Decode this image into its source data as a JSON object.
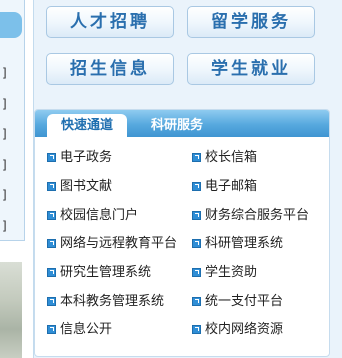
{
  "quick_buttons": [
    "人才招聘",
    "留学服务",
    "招生信息",
    "学生就业"
  ],
  "tabs": {
    "active": "快速通道",
    "inactive": "科研服务"
  },
  "links_left": [
    "电子政务",
    "图书文献",
    "校园信息门户",
    "网络与远程教育平台",
    "研究生管理系统",
    "本科教务管理系统",
    "信息公开"
  ],
  "links_right": [
    "校长信箱",
    "电子邮箱",
    "财务综合服务平台",
    "科研管理系统",
    "学生资助",
    "统一支付平台",
    "校内网络资源"
  ],
  "left_marks": [
    "]",
    "]",
    "]",
    "]",
    "]",
    "]"
  ],
  "colors": {
    "accent": "#2a6fae",
    "tab_bar": "#4ea1d9",
    "panel_bg": "#eaf3fb"
  },
  "icons": {
    "link_bullet": "arrow-square-icon"
  }
}
